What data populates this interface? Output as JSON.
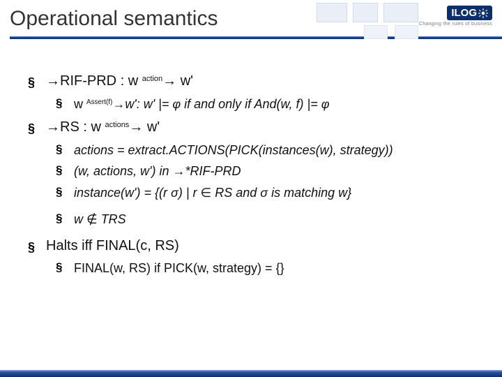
{
  "header": {
    "title": "Operational semantics",
    "brand": "ILOG",
    "tagline": "Changing the rules of business"
  },
  "items": {
    "rif": {
      "pre": "→RIF-PRD : w ",
      "sup": "action",
      "arrow": "→",
      "post": " w'",
      "sub": {
        "a": "w ",
        "asup": "Assert(f)",
        "aarrow": "→",
        "atail": "w': w' |= φ if and only if ",
        "aitalic": "And(w, f)",
        "aend": " |= φ"
      }
    },
    "rs": {
      "pre": "→RS : w ",
      "sup": "actions",
      "arrow": "→",
      "post": " w'",
      "subs": {
        "s1a": "actions = extract.ACTIONS(PICK(instances(w), strategy))",
        "s2a": "(w, actions, w') in ",
        "s2b": "→*RIF-PRD",
        "s3a": "instance(w') = {(r σ) | r ",
        "s3b": "∈",
        "s3c": " RS and σ is matching w}",
        "s4a": "w ",
        "s4b": "∉",
        "s4c": " TRS"
      }
    },
    "halt": {
      "line": "Halts iff FINAL(c, RS)",
      "sub": "FINAL(w, RS) if PICK(w, strategy) = {}"
    }
  }
}
